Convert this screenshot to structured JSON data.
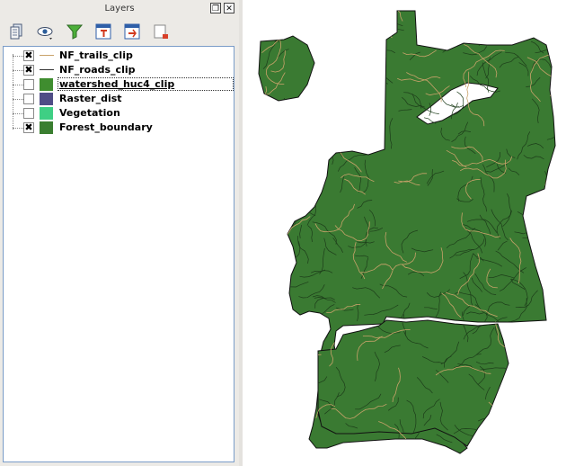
{
  "panel": {
    "title": "Layers",
    "float_glyph": "❐",
    "close_glyph": "✕"
  },
  "toolbar": {
    "icons": [
      "add-group-icon",
      "visibility-eye-icon",
      "filter-legend-icon",
      "expand-all-icon",
      "collapse-all-icon",
      "remove-layer-icon"
    ]
  },
  "layers": [
    {
      "name": "NF_trails_clip",
      "checked": true,
      "symbol": "line",
      "color": "#c8a26a"
    },
    {
      "name": "NF_roads_clip",
      "checked": true,
      "symbol": "line",
      "color": "#333333"
    },
    {
      "name": "watershed_huc4_clip",
      "checked": false,
      "symbol": "fill",
      "color": "#3f8d2f",
      "selected": true
    },
    {
      "name": "Raster_dist",
      "checked": false,
      "symbol": "fill",
      "color": "#4f4d86"
    },
    {
      "name": "Vegetation",
      "checked": false,
      "symbol": "fill",
      "color": "#3fcf84"
    },
    {
      "name": "Forest_boundary",
      "checked": true,
      "symbol": "fill",
      "color": "#3a7e30"
    }
  ],
  "check_glyph": "✖",
  "map": {
    "fill_color": "#3a7a32",
    "outline_color": "#111111",
    "trail_color": "#c8a26a"
  }
}
